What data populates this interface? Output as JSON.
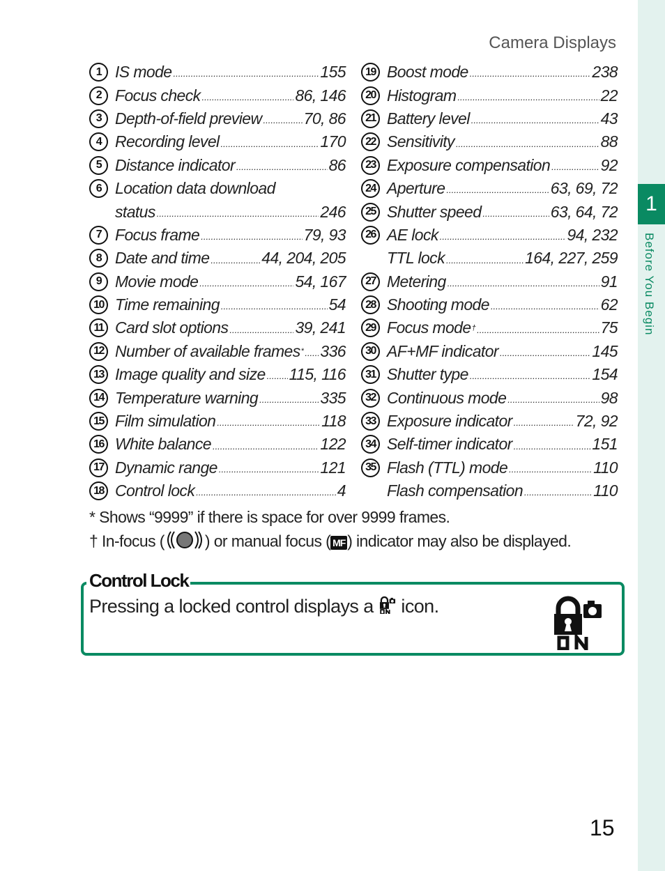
{
  "header": {
    "running_head": "Camera Displays"
  },
  "side_tab": {
    "chapter_number": "1",
    "chapter_title": "Before You Begin",
    "accent_color": "#0a8a62",
    "tab_bg": "#e3f2ee"
  },
  "page_number": "15",
  "left_column": [
    {
      "num": "1",
      "name": "IS mode",
      "pages": "155"
    },
    {
      "num": "2",
      "name": "Focus check",
      "pages": "86, 146"
    },
    {
      "num": "3",
      "name": "Depth-of-field preview",
      "pages": "70, 86"
    },
    {
      "num": "4",
      "name": "Recording level",
      "pages": "170"
    },
    {
      "num": "5",
      "name": "Distance indicator",
      "pages": "86"
    },
    {
      "num": "6",
      "name": "Location data download",
      "pages": ""
    },
    {
      "num": "",
      "name": "status",
      "pages": "246"
    },
    {
      "num": "7",
      "name": "Focus frame",
      "pages": "79, 93"
    },
    {
      "num": "8",
      "name": "Date and time",
      "pages": "44, 204, 205"
    },
    {
      "num": "9",
      "name": "Movie mode",
      "pages": "54, 167"
    },
    {
      "num": "10",
      "name": "Time remaining",
      "pages": "54"
    },
    {
      "num": "11",
      "name": "Card slot options",
      "pages": "39, 241"
    },
    {
      "num": "12",
      "name": "Number of available frames",
      "sup": "*",
      "pages": "336"
    },
    {
      "num": "13",
      "name": "Image quality and size",
      "pages": "115, 116"
    },
    {
      "num": "14",
      "name": "Temperature warning",
      "pages": "335"
    },
    {
      "num": "15",
      "name": "Film simulation",
      "pages": "118"
    },
    {
      "num": "16",
      "name": "White balance",
      "pages": "122"
    },
    {
      "num": "17",
      "name": "Dynamic range",
      "pages": "121"
    },
    {
      "num": "18",
      "name": "Control lock",
      "pages": "4"
    }
  ],
  "right_column": [
    {
      "num": "19",
      "name": "Boost mode",
      "pages": "238"
    },
    {
      "num": "20",
      "name": "Histogram",
      "pages": "22"
    },
    {
      "num": "21",
      "name": "Battery level",
      "pages": "43"
    },
    {
      "num": "22",
      "name": "Sensitivity",
      "pages": "88"
    },
    {
      "num": "23",
      "name": "Exposure compensation",
      "pages": "92"
    },
    {
      "num": "24",
      "name": "Aperture",
      "pages": "63, 69, 72"
    },
    {
      "num": "25",
      "name": "Shutter speed",
      "pages": "63, 64, 72"
    },
    {
      "num": "26",
      "name": "AE lock",
      "pages": "94, 232"
    },
    {
      "num": "",
      "name": "TTL lock",
      "pages": "164, 227, 259"
    },
    {
      "num": "27",
      "name": "Metering",
      "pages": "91"
    },
    {
      "num": "28",
      "name": "Shooting mode",
      "pages": "62"
    },
    {
      "num": "29",
      "name": "Focus mode",
      "sup": "†",
      "pages": "75"
    },
    {
      "num": "30",
      "name": "AF+MF indicator",
      "pages": "145"
    },
    {
      "num": "31",
      "name": "Shutter type",
      "pages": "154"
    },
    {
      "num": "32",
      "name": "Continuous mode",
      "pages": "98"
    },
    {
      "num": "33",
      "name": "Exposure indicator",
      "pages": "72, 92"
    },
    {
      "num": "34",
      "name": "Self-timer indicator",
      "pages": "151"
    },
    {
      "num": "35",
      "name": "Flash (TTL) mode",
      "pages": "110"
    },
    {
      "num": "",
      "name": "Flash compensation",
      "pages": "110"
    }
  ],
  "footnotes": {
    "asterisk": "* Shows “9999” if there is space for over 9999 frames.",
    "dagger_prefix": "† In-focus (",
    "dagger_infocus_icon": "in-focus-indicator-icon",
    "dagger_middle": ") or manual focus (",
    "dagger_mf_label": "MF",
    "dagger_suffix": ") indicator may also be displayed."
  },
  "note": {
    "title": "Control Lock",
    "text_before": "Pressing a locked control displays a ",
    "inline_icon": "control-lock-on-icon",
    "text_after": " icon.",
    "big_icon": "control-lock-on-icon",
    "icon_label": "ON"
  }
}
